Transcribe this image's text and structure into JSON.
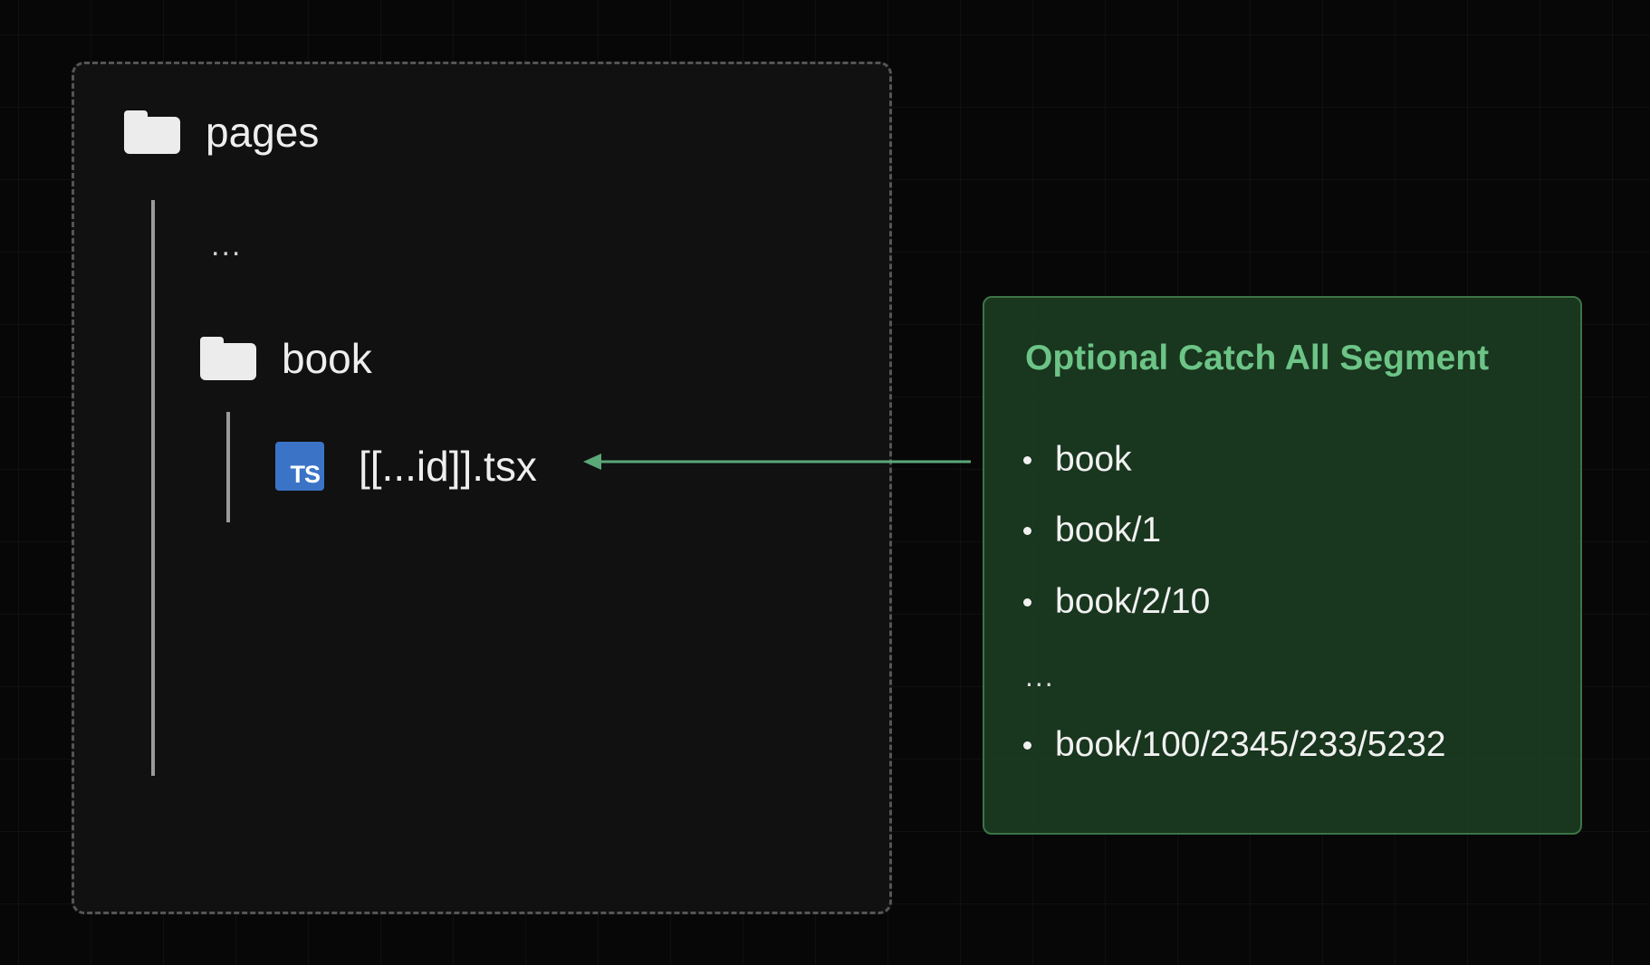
{
  "tree": {
    "root_folder": "pages",
    "ellipsis": "...",
    "sub_folder": "book",
    "file_badge": "TS",
    "file_name": "[[...id]].tsx"
  },
  "card": {
    "title": "Optional Catch All Segment",
    "routes": [
      "book",
      "book/1",
      "book/2/10"
    ],
    "ellipsis": "...",
    "last_route": "book/100/2345/233/5232"
  },
  "colors": {
    "arrow": "#5aa878",
    "card_title": "#6cc486",
    "ts_badge": "#3b74c7"
  },
  "icons": {
    "folder": "folder-icon",
    "file": "typescript-file-icon"
  }
}
